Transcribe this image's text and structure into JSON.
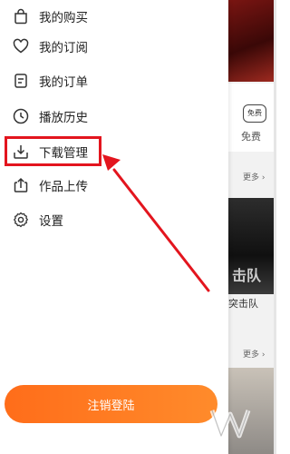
{
  "menu": {
    "items": [
      {
        "label": "我的购买",
        "icon": "shopping-bag-icon"
      },
      {
        "label": "我的订阅",
        "icon": "heart-icon"
      },
      {
        "label": "我的订单",
        "icon": "order-list-icon"
      },
      {
        "label": "播放历史",
        "icon": "clock-icon"
      },
      {
        "label": "下载管理",
        "icon": "download-icon"
      },
      {
        "label": "作品上传",
        "icon": "upload-icon"
      },
      {
        "label": "设置",
        "icon": "gear-icon"
      }
    ],
    "logout_label": "注销登陆"
  },
  "background": {
    "free_badge": "免费",
    "free_label": "免费",
    "more_label_1": "更多 ›",
    "more_label_2": "更多 ›",
    "poster_title": "击队",
    "poster_caption": "突击队"
  },
  "colors": {
    "accent": "#ff7a1f",
    "annotation_red": "#e3151e"
  }
}
